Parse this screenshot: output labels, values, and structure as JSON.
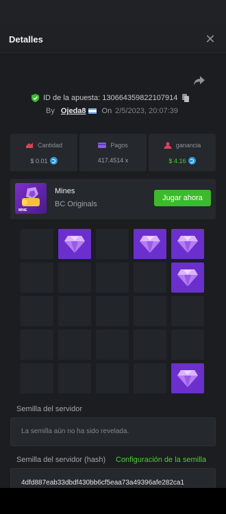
{
  "header": {
    "title": "Detalles",
    "close_icon": "close-icon"
  },
  "bet": {
    "id_label": "ID de la apuesta: 130664359822107914",
    "by_label": "By",
    "user": "Ojeda8",
    "on_label": "On",
    "date": "2/5/2023, 20:07:39"
  },
  "stats": {
    "amount": {
      "label": "Cantidad",
      "value": "$ 0.01",
      "icon": "amount-icon"
    },
    "payout": {
      "label": "Pagos",
      "value": "417.4514 x",
      "icon": "card-icon"
    },
    "profit": {
      "label": "ganancia",
      "value": "$ 4.16",
      "icon": "profit-icon"
    }
  },
  "game": {
    "name": "Mines",
    "provider": "BC Originals",
    "thumb_text": "MINE",
    "play_label": "Jugar ahora"
  },
  "grid": {
    "rows": [
      [
        false,
        true,
        false,
        true,
        true
      ],
      [
        false,
        false,
        false,
        false,
        true
      ],
      [
        false,
        false,
        false,
        false,
        false
      ],
      [
        false,
        false,
        false,
        false,
        false
      ],
      [
        false,
        false,
        false,
        false,
        true
      ]
    ]
  },
  "server_seed": {
    "label": "Semilla del servidor",
    "value": "La semilla aún no ha sido revelada.",
    "hash_label": "Semilla del servidor (hash)",
    "config_link": "Configuración de la semilla",
    "hash": "4dfd887eab33dbdf430bb6cf5eaa73a49396afe282ca1"
  },
  "colors": {
    "accent_green": "#3cba2c",
    "gem_purple": "#6a2fcc",
    "coin_blue": "#2f9bd6"
  }
}
